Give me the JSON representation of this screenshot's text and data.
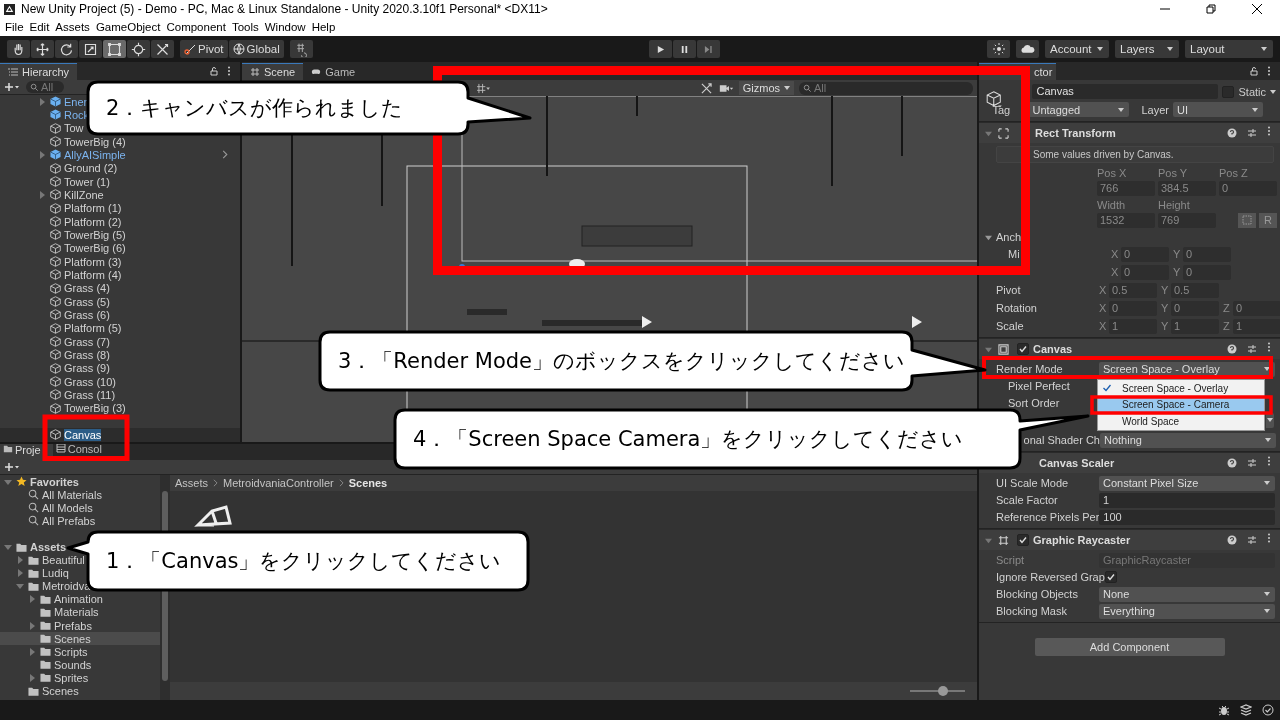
{
  "window": {
    "title": "New Unity Project (5) - Demo - PC, Mac & Linux Standalone - Unity 2020.3.10f1 Personal* <DX11>"
  },
  "menu": [
    "File",
    "Edit",
    "Assets",
    "GameObject",
    "Component",
    "Tools",
    "Window",
    "Help"
  ],
  "toolbar": {
    "tools": [
      {
        "kind": "hand",
        "selected": false
      },
      {
        "kind": "move",
        "selected": false
      },
      {
        "kind": "rotate",
        "selected": false
      },
      {
        "kind": "scale",
        "selected": false
      },
      {
        "kind": "rect",
        "selected": true
      },
      {
        "kind": "transform",
        "selected": false
      },
      {
        "kind": "custom",
        "selected": false
      }
    ],
    "pivot": "Pivot",
    "global": "Global",
    "account": "Account",
    "layers": "Layers",
    "layout": "Layout"
  },
  "hierarchy": {
    "title": "Hierarchy",
    "search_placeholder": "All",
    "items": [
      {
        "label": "Ener",
        "kind": "prefab",
        "expanded": false,
        "selected": false
      },
      {
        "label": "Rock",
        "kind": "prefab",
        "selected": false
      },
      {
        "label": "Tow",
        "kind": "object",
        "selected": false
      },
      {
        "label": "TowerBig (4)",
        "kind": "object",
        "selected": false
      },
      {
        "label": "AllyAISimple",
        "kind": "prefab",
        "expanded": false,
        "chevron": true,
        "selected": false
      },
      {
        "label": "Ground (2)",
        "kind": "object",
        "selected": false
      },
      {
        "label": "Tower (1)",
        "kind": "object",
        "selected": false
      },
      {
        "label": "KillZone",
        "kind": "object",
        "expanded": false,
        "selected": false
      },
      {
        "label": "Platform (1)",
        "kind": "object",
        "selected": false
      },
      {
        "label": "Platform (2)",
        "kind": "object",
        "selected": false
      },
      {
        "label": "TowerBig (5)",
        "kind": "object",
        "selected": false
      },
      {
        "label": "TowerBig (6)",
        "kind": "object",
        "selected": false
      },
      {
        "label": "Platform (3)",
        "kind": "object",
        "selected": false
      },
      {
        "label": "Platform (4)",
        "kind": "object",
        "selected": false
      },
      {
        "label": "Grass (4)",
        "kind": "object",
        "selected": false
      },
      {
        "label": "Grass (5)",
        "kind": "object",
        "selected": false
      },
      {
        "label": "Grass (6)",
        "kind": "object",
        "selected": false
      },
      {
        "label": "Platform (5)",
        "kind": "object",
        "selected": false
      },
      {
        "label": "Grass (7)",
        "kind": "object",
        "selected": false
      },
      {
        "label": "Grass (8)",
        "kind": "object",
        "selected": false
      },
      {
        "label": "Grass (9)",
        "kind": "object",
        "selected": false
      },
      {
        "label": "Grass (10)",
        "kind": "object",
        "selected": false
      },
      {
        "label": "Grass (11)",
        "kind": "object",
        "selected": false
      },
      {
        "label": "TowerBig (3)",
        "kind": "object",
        "selected": false
      },
      {
        "label": "Canvas",
        "kind": "object",
        "selected": true
      }
    ]
  },
  "scene": {
    "tabs": [
      {
        "label": "Scene",
        "selected": true
      },
      {
        "label": "Game",
        "selected": false
      }
    ],
    "gizmos": "Gizmos",
    "search_placeholder": "All"
  },
  "project": {
    "tabs": [
      {
        "label": "Proje",
        "selected": true
      },
      {
        "label": "Consol",
        "selected": false
      }
    ],
    "tree": [
      {
        "label": "Favorites",
        "kind": "favorites",
        "expanded": true,
        "selected": false,
        "children": [
          {
            "label": "All Materials",
            "kind": "search",
            "selected": false
          },
          {
            "label": "All Models",
            "kind": "search",
            "selected": false
          },
          {
            "label": "All Prefabs",
            "kind": "search",
            "selected": false
          }
        ]
      },
      {
        "label": "Assets",
        "kind": "folder",
        "expanded": true,
        "selected": false,
        "children": [
          {
            "label": "Beautiful",
            "kind": "folder",
            "expanded": false,
            "selected": false
          },
          {
            "label": "Ludiq",
            "kind": "folder",
            "expanded": false,
            "selected": false
          },
          {
            "label": "Metroidva",
            "kind": "folder",
            "expanded": true,
            "selected": false,
            "children": [
              {
                "label": "Animation",
                "kind": "folder",
                "expanded": false,
                "selected": false
              },
              {
                "label": "Materials",
                "kind": "folder",
                "selected": false
              },
              {
                "label": "Prefabs",
                "kind": "folder",
                "expanded": false,
                "selected": false
              },
              {
                "label": "Scenes",
                "kind": "folder",
                "selected": true
              },
              {
                "label": "Scripts",
                "kind": "folder",
                "expanded": false,
                "selected": false
              },
              {
                "label": "Sounds",
                "kind": "folder",
                "selected": false
              },
              {
                "label": "Sprites",
                "kind": "folder",
                "expanded": false,
                "selected": false
              }
            ]
          },
          {
            "label": "Scenes",
            "kind": "folder",
            "selected": false
          }
        ]
      }
    ],
    "breadcrumb": [
      "Assets",
      "MetroidvaniaController",
      "Scenes"
    ],
    "icon_size_slider": {
      "level": 0.6
    }
  },
  "inspector": {
    "tab": "ctor",
    "name": "Canvas",
    "static": {
      "label": "Static",
      "checked": false
    },
    "tag": {
      "label": "Tag",
      "value": "Untagged"
    },
    "layer": {
      "label": "Layer",
      "value": "UI"
    },
    "components": [
      {
        "kind": "rect",
        "title": "Rect Transform",
        "rows": [
          {
            "kind": "note",
            "text": "Some values driven by Canvas."
          },
          {
            "kind": "grid",
            "labels": [
              "Pos X",
              "Pos Y",
              "Pos Z"
            ],
            "values": [
              "766",
              "384.5",
              "0"
            ]
          },
          {
            "kind": "grid",
            "labels": [
              "Width",
              "Height"
            ],
            "values": [
              "1532",
              "769"
            ],
            "button": "R"
          },
          {
            "kind": "group",
            "label": "Anch",
            "expanded": true,
            "children": [
              {
                "kind": "vector",
                "label": "Mi",
                "axes": [
                  {
                    "axis": "X",
                    "value": "0"
                  },
                  {
                    "axis": "Y",
                    "value": "0"
                  }
                ]
              },
              {
                "kind": "vector",
                "axes": [
                  {
                    "axis": "X",
                    "value": "0"
                  },
                  {
                    "axis": "Y",
                    "value": "0"
                  }
                ]
              }
            ]
          },
          {
            "kind": "vector",
            "label": "Pivot",
            "axes": [
              {
                "axis": "X",
                "value": "0.5"
              },
              {
                "axis": "Y",
                "value": "0.5"
              }
            ]
          },
          {
            "kind": "vector",
            "label": "Rotation",
            "axes": [
              {
                "axis": "X",
                "value": "0"
              },
              {
                "axis": "Y",
                "value": "0"
              },
              {
                "axis": "Z",
                "value": "0"
              }
            ]
          },
          {
            "kind": "vector",
            "label": "Scale",
            "axes": [
              {
                "axis": "X",
                "value": "1"
              },
              {
                "axis": "Y",
                "value": "1"
              },
              {
                "axis": "Z",
                "value": "1"
              }
            ]
          }
        ]
      },
      {
        "kind": "canvas",
        "title": "Canvas",
        "enabled": true,
        "rows": [
          {
            "kind": "dropdown",
            "label": "Render Mode",
            "value": "Screen Space - Overlay",
            "children": [
              {
                "kind": "label",
                "label": "Pixel Perfect"
              },
              {
                "kind": "label",
                "label": "Sort Order"
              },
              {
                "kind": "dropdown"
              }
            ]
          },
          {
            "kind": "dropdown",
            "label": "onal Shader Ch",
            "label_cut": true,
            "value": "Nothing"
          }
        ]
      },
      {
        "kind": "scaler",
        "title": "Canvas Scaler",
        "rows": [
          {
            "kind": "dropdown",
            "label": "UI Scale Mode",
            "value": "Constant Pixel Size"
          },
          {
            "kind": "field",
            "label": "Scale Factor",
            "value": "1"
          },
          {
            "kind": "field",
            "label": "Reference Pixels Per",
            "value": "100"
          }
        ]
      },
      {
        "kind": "raycaster",
        "title": "Graphic Raycaster",
        "enabled": true,
        "rows": [
          {
            "kind": "script",
            "label": "Script",
            "value": "GraphicRaycaster"
          },
          {
            "kind": "checkbox",
            "label": "Ignore Reversed Grap",
            "checked": true
          },
          {
            "kind": "dropdown",
            "label": "Blocking Objects",
            "value": "None"
          },
          {
            "kind": "dropdown",
            "label": "Blocking Mask",
            "value": "Everything"
          }
        ]
      }
    ],
    "add_component": "Add Component"
  },
  "render_mode_menu": [
    {
      "label": "Screen Space - Overlay",
      "checked": true,
      "selected": false
    },
    {
      "label": "Screen Space - Camera",
      "checked": false,
      "selected": true
    },
    {
      "label": "World Space",
      "checked": false,
      "selected": false
    }
  ],
  "callouts": [
    "2．キャンバスが作られました",
    "3．「Render Mode」のボックスをクリックしてください",
    "4．「Screen Space Camera」をクリックしてください",
    "1．「Canvas」をクリックしてください"
  ]
}
